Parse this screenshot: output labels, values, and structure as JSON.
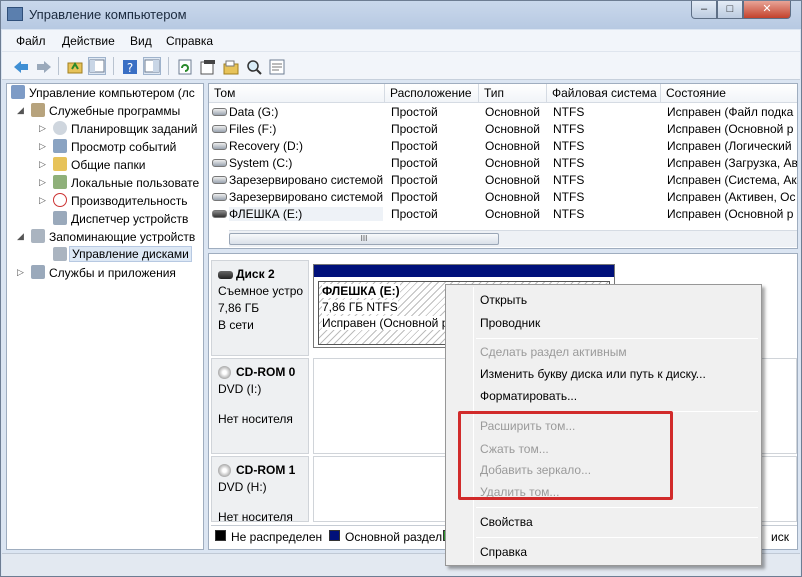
{
  "window": {
    "title": "Управление компьютером",
    "controls": {
      "minimize": "–",
      "maximize": "□",
      "close": "✕"
    }
  },
  "menu": [
    "Файл",
    "Действие",
    "Вид",
    "Справка"
  ],
  "toolbar_icons": [
    "back-arrow-icon",
    "forward-arrow-icon",
    "up-folder-icon",
    "show-hide-tree-icon",
    "help-icon",
    "properties-pane-icon",
    "refresh-icon",
    "export-icon",
    "open-icon",
    "search-icon",
    "settings-icon"
  ],
  "tree": {
    "root": "Управление компьютером (лс",
    "utilities": "Служебные программы",
    "task_scheduler": "Планировщик заданий",
    "event_viewer": "Просмотр событий",
    "shared_folders": "Общие папки",
    "local_users": "Локальные пользовате",
    "performance": "Производительность",
    "device_manager": "Диспетчер устройств",
    "storage": "Запоминающие устройств",
    "disk_management": "Управление дисками",
    "services": "Службы и приложения"
  },
  "volumes": {
    "headers": [
      "Том",
      "Расположение",
      "Тип",
      "Файловая система",
      "Состояние"
    ],
    "rows": [
      [
        "Data (G:)",
        "Простой",
        "Основной",
        "NTFS",
        "Исправен (Файл подка"
      ],
      [
        "Files (F:)",
        "Простой",
        "Основной",
        "NTFS",
        "Исправен (Основной р"
      ],
      [
        "Recovery (D:)",
        "Простой",
        "Основной",
        "NTFS",
        "Исправен (Логический"
      ],
      [
        "System (C:)",
        "Простой",
        "Основной",
        "NTFS",
        "Исправен (Загрузка, Ав"
      ],
      [
        "Зарезервировано системой",
        "Простой",
        "Основной",
        "NTFS",
        "Исправен (Система, Ак"
      ],
      [
        "Зарезервировано системой",
        "Простой",
        "Основной",
        "NTFS",
        "Исправен (Активен, Ос"
      ],
      [
        "ФЛЕШКА  (E:)",
        "Простой",
        "Основной",
        "NTFS",
        "Исправен (Основной р"
      ]
    ],
    "scroll_thumb": "III"
  },
  "disks": {
    "disk2": {
      "name": "Диск 2",
      "type": "Съемное устро",
      "size": "7,86 ГБ",
      "status": "В сети"
    },
    "partition": {
      "name": "ФЛЕШКА  (E:)",
      "size": "7,86 ГБ NTFS",
      "status": "Исправен (Основной р"
    },
    "cdrom0": {
      "name": "CD-ROM 0",
      "drive": "DVD (I:)",
      "status": "Нет носителя"
    },
    "cdrom1": {
      "name": "CD-ROM 1",
      "drive": "DVD (H:)",
      "status": "Нет носителя"
    }
  },
  "legend": {
    "unallocated": "Не распределен",
    "primary": "Основной раздел",
    "tail": "иск",
    "colors": {
      "unallocated": "#000000",
      "primary": "#00107a",
      "logical": "#2e9b2e"
    }
  },
  "context_menu": {
    "open": "Открыть",
    "explorer": "Проводник",
    "mark_active": "Сделать раздел активным",
    "change_letter": "Изменить букву диска или путь к диску...",
    "format": "Форматировать...",
    "extend": "Расширить том...",
    "shrink": "Сжать том...",
    "add_mirror": "Добавить зеркало...",
    "delete": "Удалить том...",
    "properties": "Свойства",
    "help": "Справка"
  },
  "accent_colors": {
    "highlight_box": "#d12b2b",
    "partition_bar": "#00107a"
  }
}
